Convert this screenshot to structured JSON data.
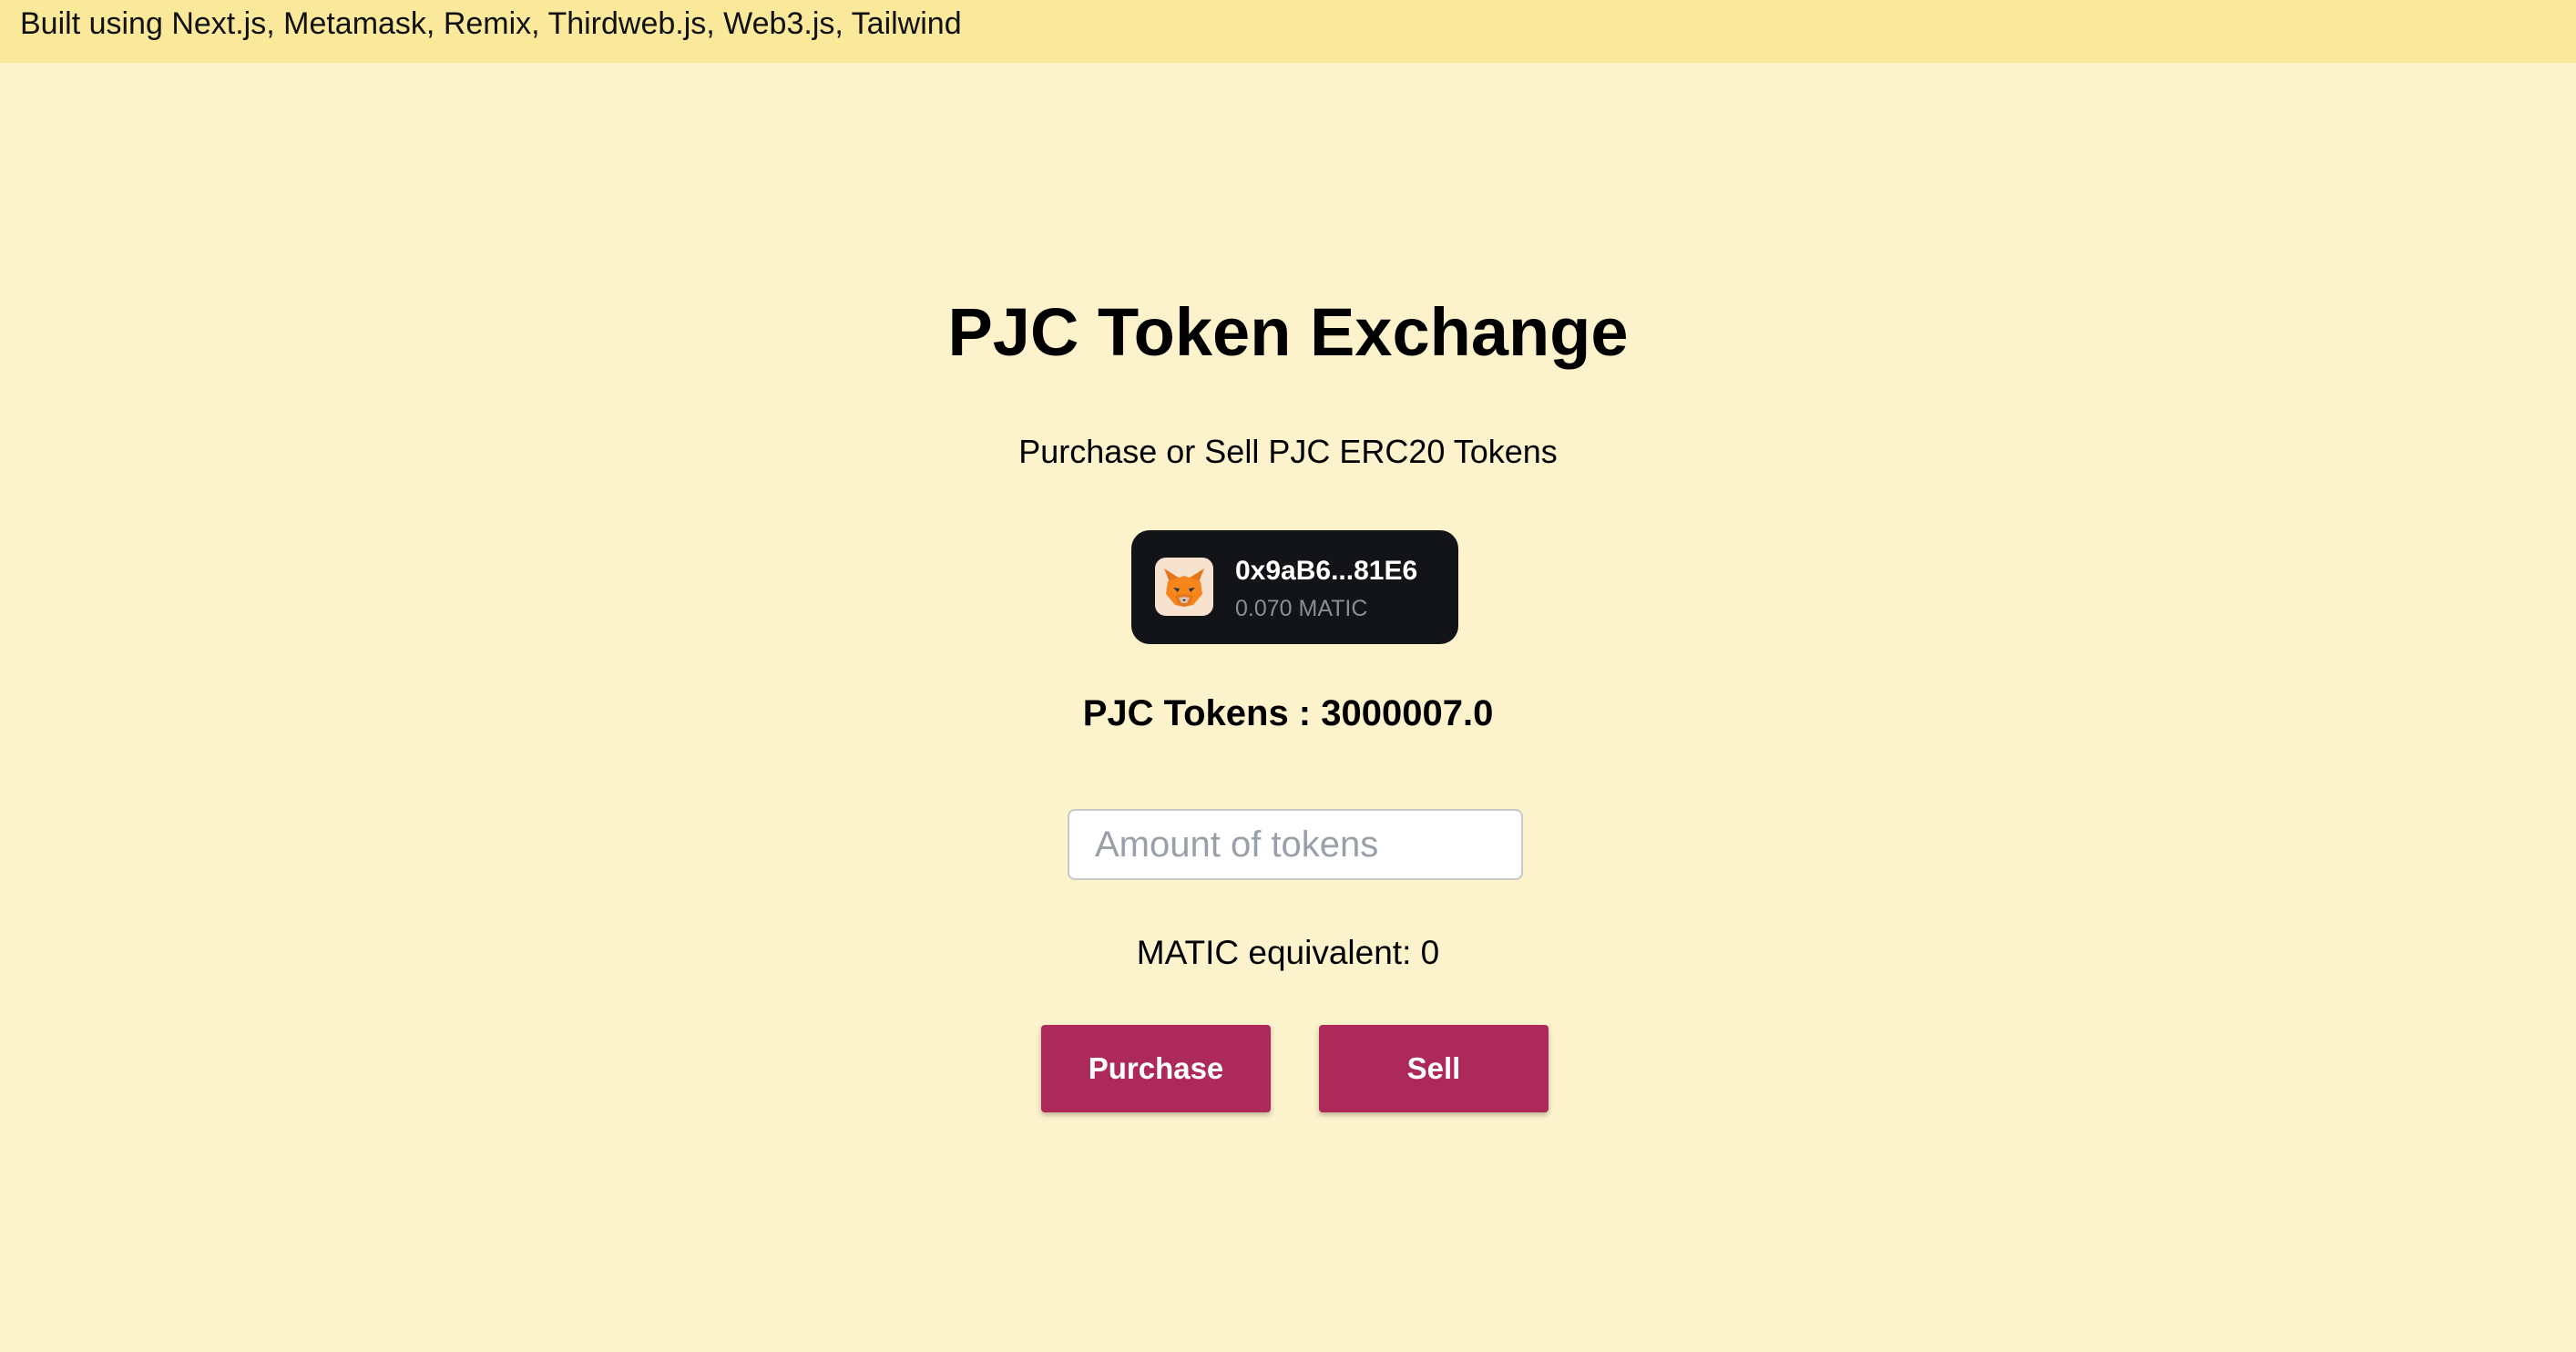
{
  "topbar": {
    "text": "Built using Next.js, Metamask, Remix, Thirdweb.js, Web3.js, Tailwind"
  },
  "main": {
    "title": "PJC Token Exchange",
    "subtitle": "Purchase or Sell PJC ERC20 Tokens",
    "wallet": {
      "icon": "metamask-fox-icon",
      "address": "0x9aB6...81E6",
      "balance": "0.070 MATIC"
    },
    "tokens_text": "PJC Tokens : 3000007.0",
    "amount_input": {
      "value": "",
      "placeholder": "Amount of tokens"
    },
    "equivalent_text": "MATIC equivalent: 0",
    "purchase_label": "Purchase",
    "sell_label": "Sell"
  },
  "colors": {
    "background": "#fcf2cc",
    "topbar": "#fae89b",
    "wallet_bg": "#131418",
    "button": "#ad295a",
    "button_text": "#ffffff"
  }
}
